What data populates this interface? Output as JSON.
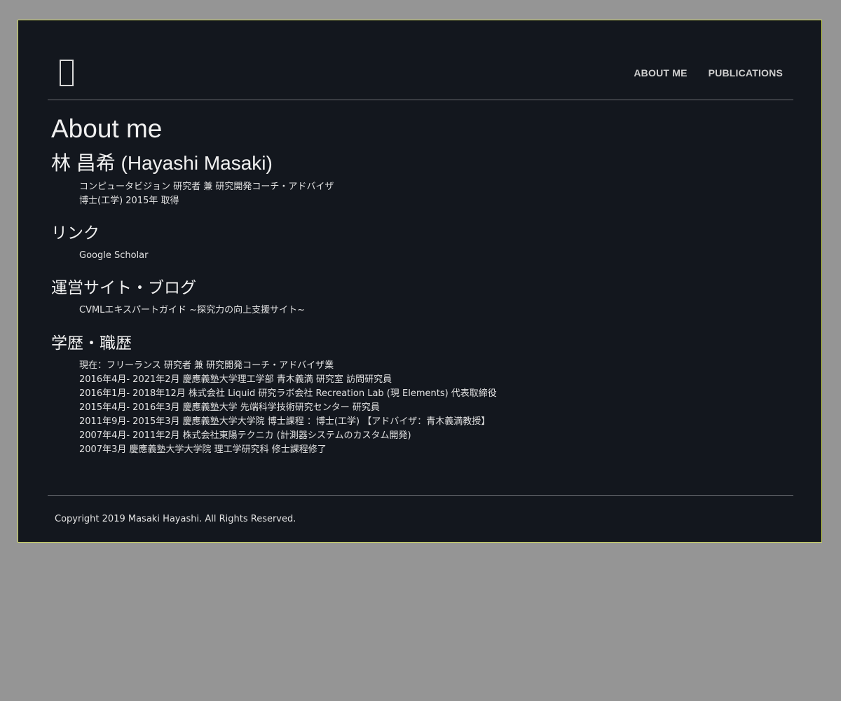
{
  "nav": {
    "about": "ABOUT ME",
    "publications": "PUBLICATIONS"
  },
  "page": {
    "title": "About me"
  },
  "profile": {
    "name": "林 昌希 (Hayashi Masaki)",
    "role": "コンピュータビジョン 研究者 兼 研究開発コーチ・アドバイザ",
    "degree": "博士(工学) 2015年 取得"
  },
  "links": {
    "heading": "リンク",
    "items": [
      "Google Scholar"
    ]
  },
  "sites": {
    "heading": "運営サイト・ブログ",
    "items": [
      "CVMLエキスパートガイド ~探究力の向上支援サイト~"
    ]
  },
  "career": {
    "heading": "学歴・職歴",
    "items": [
      "現在：フリーランス 研究者 兼 研究開発コーチ・アドバイザ業",
      "2016年4月- 2021年2月 慶應義塾大学理工学部 青木義満 研究室 訪問研究員",
      "2016年1月- 2018年12月 株式会社 Liquid 研究ラボ会社 Recreation Lab (現 Elements) 代表取締役",
      "2015年4月- 2016年3月 慶應義塾大学 先端科学技術研究センター 研究員",
      "2011年9月- 2015年3月 慶應義塾大学大学院 博士課程 ：博士(工学) 【アドバイザ：青木義満教授】",
      "2007年4月- 2011年2月 株式会社東陽テクニカ (計測器システムのカスタム開発)",
      "2007年3月 慶應義塾大学大学院 理工学研究科 修士課程修了"
    ]
  },
  "footer": {
    "copyright": "Copyright 2019 Masaki Hayashi. All Rights Reserved."
  }
}
